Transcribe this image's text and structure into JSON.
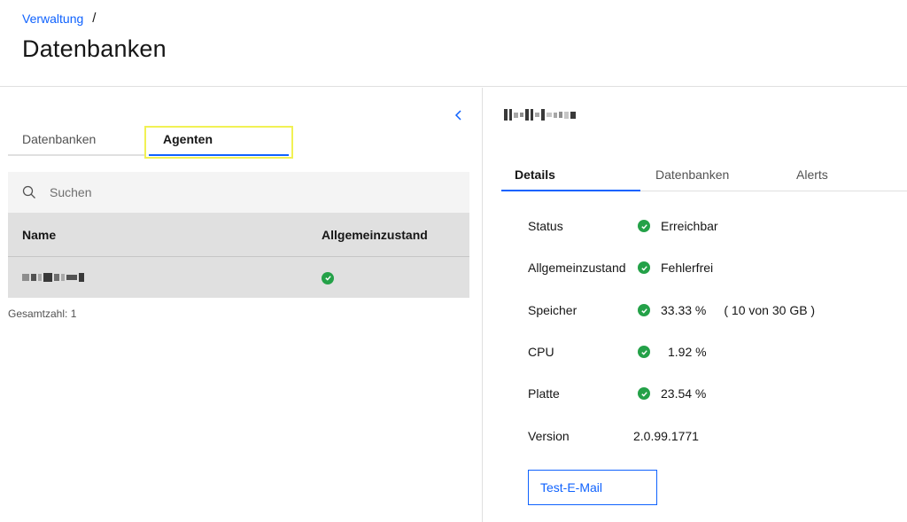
{
  "breadcrumb": {
    "parent": "Verwaltung",
    "separator": "/"
  },
  "page": {
    "title": "Datenbanken"
  },
  "left": {
    "tabs": [
      {
        "label": "Datenbanken"
      },
      {
        "label": "Agenten"
      }
    ],
    "search": {
      "placeholder": "Suchen"
    },
    "table": {
      "columns": [
        "Name",
        "Allgemeinzustand"
      ],
      "rows": [
        {
          "name": "",
          "status": "ok"
        }
      ]
    },
    "total": "Gesamtzahl: 1"
  },
  "right": {
    "tabs": [
      {
        "label": "Details"
      },
      {
        "label": "Datenbanken"
      },
      {
        "label": "Alerts"
      }
    ],
    "details": {
      "status_label": "Status",
      "status_value": "Erreichbar",
      "health_label": "Allgemeinzustand",
      "health_value": "Fehlerfrei",
      "memory_label": "Speicher",
      "memory_value": "33.33 %",
      "memory_extra": "( 10 von 30 GB )",
      "cpu_label": "CPU",
      "cpu_value": "1.92 %",
      "disk_label": "Platte",
      "disk_value": "23.54 %",
      "version_label": "Version",
      "version_value": "2.0.99.1771"
    },
    "test_button": "Test-E-Mail"
  },
  "colors": {
    "accent": "#0f62fe",
    "success": "#24a148",
    "highlight": "#f1f154"
  }
}
